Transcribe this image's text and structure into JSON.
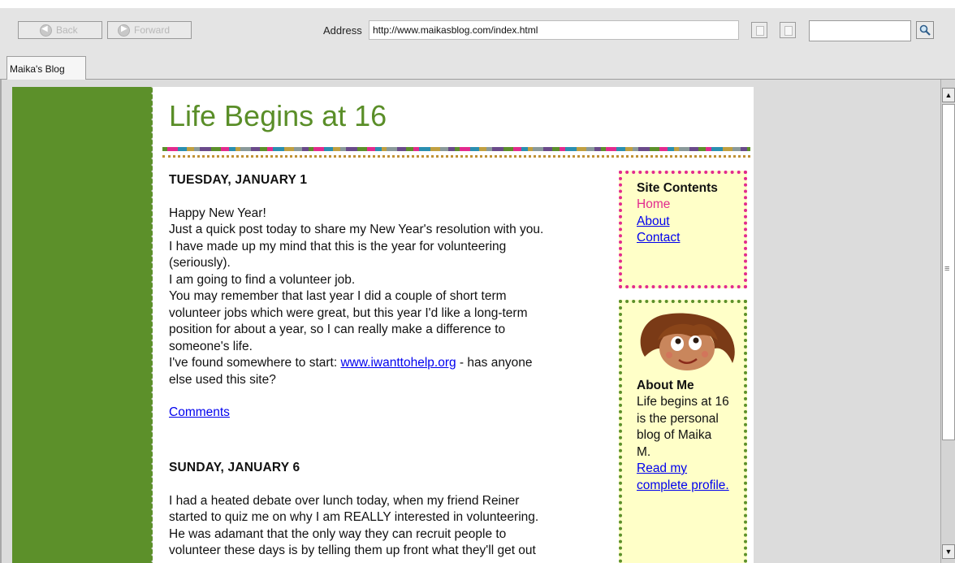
{
  "toolbar": {
    "back_label": "Back",
    "forward_label": "Forward",
    "address_label": "Address",
    "address_value": "http://www.maikasblog.com/index.html",
    "search_value": ""
  },
  "tabs": [
    {
      "label": "Maika's Blog",
      "active": true
    }
  ],
  "blog": {
    "title": "Life Begins at 16",
    "posts": [
      {
        "date": "TUESDAY, JANUARY 1",
        "lines": [
          "Happy New Year!",
          "Just a quick post today to share my New Year's resolution with you.",
          "I have made up my mind that this is the year for volunteering",
          "(seriously).",
          "I am going to find a volunteer job.",
          "You may remember that last year I did a couple of short term",
          "volunteer jobs which were great, but this year I'd like a long-term",
          "position for about a year, so I can really make a difference to",
          "someone's life."
        ],
        "link_prefix": "I've found somewhere to start: ",
        "link_text": "www.iwanttohelp.org",
        "link_suffix": " - has anyone",
        "link_line2": "else used this site?",
        "comments_label": "Comments"
      },
      {
        "date": "SUNDAY, JANUARY 6",
        "lines": [
          "I had a heated debate over lunch today, when my friend Reiner",
          "started to quiz me on why I am REALLY interested in volunteering.",
          "He was adamant that the only way they can recruit people to",
          "volunteer these days is by telling them up front what they'll get out"
        ]
      }
    ],
    "sidebar": {
      "contents_title": "Site Contents",
      "nav": [
        "Home",
        "About",
        "Contact"
      ],
      "about_title": "About Me",
      "about_lines": [
        "Life begins at 16",
        "is the personal",
        "blog of Maika",
        "M."
      ],
      "profile_link_lines": [
        "Read my ",
        "complete profile."
      ]
    }
  },
  "colors": {
    "accent_green": "#5c902a",
    "pink": "#e22a8e",
    "sidebar_bg": "#ffffc8",
    "link": "#0000ee"
  },
  "icons": {
    "back": "back-arrow-icon",
    "forward": "forward-arrow-icon",
    "copy": "copy-icon",
    "paste": "paste-icon",
    "search": "magnifier-icon"
  }
}
